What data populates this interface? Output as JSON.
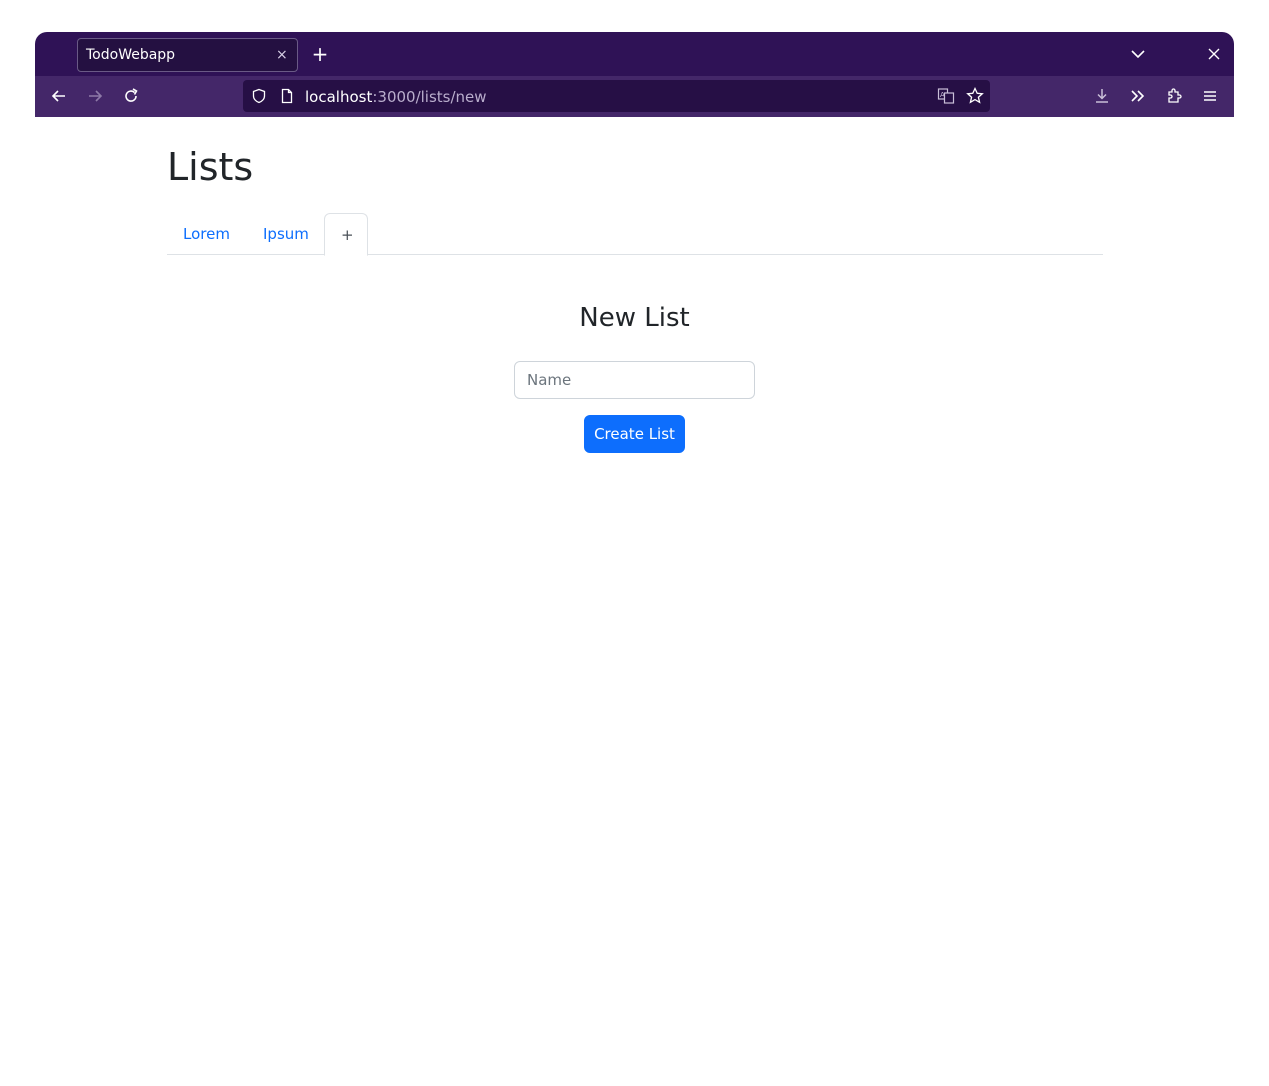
{
  "browser": {
    "tab_title": "TodoWebapp",
    "tab_close": "×",
    "new_tab": "+",
    "url_host": "localhost",
    "url_path": ":3000/lists/new",
    "theme_color": "#2f1256"
  },
  "page": {
    "title": "Lists",
    "tabs": [
      {
        "label": "Lorem",
        "active": false
      },
      {
        "label": "Ipsum",
        "active": false
      },
      {
        "label": "+",
        "active": true
      }
    ]
  },
  "form": {
    "heading": "New List",
    "name_placeholder": "Name",
    "name_value": "",
    "submit_label": "Create List",
    "accent_color": "#0d6efd"
  },
  "icons": [
    "back-icon",
    "forward-icon",
    "reload-icon",
    "shield-icon",
    "page-icon",
    "translate-icon",
    "bookmark-star-icon",
    "download-icon",
    "extensions-overflow-icon",
    "puzzle-icon",
    "menu-icon",
    "tab-list-chevron-icon",
    "window-close-icon"
  ]
}
